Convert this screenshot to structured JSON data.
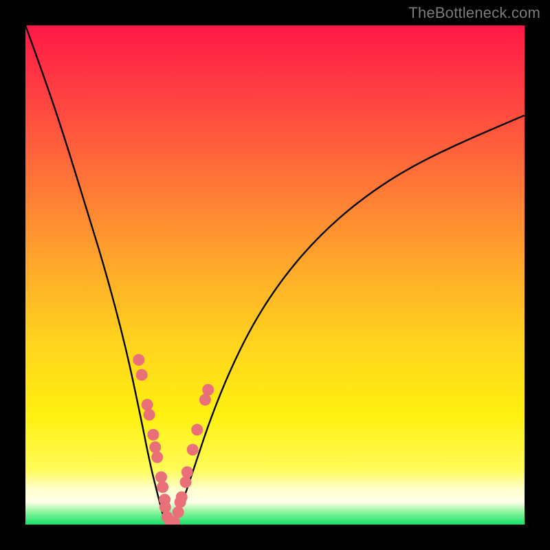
{
  "watermark": "TheBottleneck.com",
  "chart_data": {
    "type": "line",
    "title": "",
    "xlabel": "",
    "ylabel": "",
    "xlim": [
      0,
      100
    ],
    "ylim": [
      0,
      100
    ],
    "grid": false,
    "series": [
      {
        "name": "curve-left",
        "x": [
          0,
          4,
          8,
          12,
          16,
          20,
          23,
          25,
          26.5,
          27.5,
          28.2
        ],
        "y": [
          100,
          89,
          77,
          64,
          51,
          36,
          22,
          12,
          6,
          2,
          0
        ]
      },
      {
        "name": "curve-right",
        "x": [
          29.8,
          30.5,
          32,
          34,
          37,
          41,
          46,
          52,
          59,
          67,
          76,
          86,
          100
        ],
        "y": [
          0,
          2,
          6,
          12,
          21,
          31,
          41,
          50,
          58,
          65,
          71,
          76,
          82
        ]
      }
    ],
    "scatter": {
      "name": "dots",
      "color": "#e96f78",
      "points": [
        [
          22.7,
          33.0
        ],
        [
          23.3,
          30.0
        ],
        [
          24.4,
          24.0
        ],
        [
          24.8,
          22.0
        ],
        [
          25.6,
          18.0
        ],
        [
          26.0,
          15.5
        ],
        [
          26.4,
          13.5
        ],
        [
          27.2,
          9.5
        ],
        [
          27.5,
          7.5
        ],
        [
          27.9,
          5.0
        ],
        [
          28.0,
          3.5
        ],
        [
          28.4,
          1.5
        ],
        [
          29.0,
          0.5
        ],
        [
          29.8,
          0.5
        ],
        [
          30.6,
          2.5
        ],
        [
          31.0,
          4.5
        ],
        [
          31.3,
          5.5
        ],
        [
          32.1,
          8.5
        ],
        [
          32.4,
          10.5
        ],
        [
          33.5,
          15.0
        ],
        [
          34.4,
          19.0
        ],
        [
          36.0,
          25.0
        ],
        [
          36.6,
          27.0
        ]
      ]
    }
  }
}
